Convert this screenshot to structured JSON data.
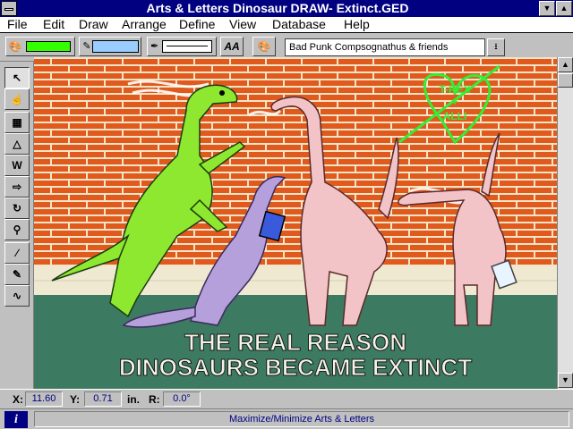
{
  "window": {
    "title": "Arts & Letters Dinosaur DRAW- Extinct.GED",
    "minimize_glyph": "▼",
    "maximize_glyph": "▲"
  },
  "menu": {
    "items": [
      "File",
      "Edit",
      "Draw",
      "Arrange",
      "Define",
      "View",
      "Database",
      "Help"
    ]
  },
  "toolbar": {
    "fill_color": "#33ff00",
    "line_color": "#99ccff",
    "font_button_label": "AA",
    "style_name": "Bad Punk Compsognathus & friends"
  },
  "palette": {
    "tools": [
      {
        "name": "select-tool",
        "glyph": "↖"
      },
      {
        "name": "hand-tool",
        "glyph": "☝"
      },
      {
        "name": "symbols-tool",
        "glyph": "▦"
      },
      {
        "name": "shapes-tool",
        "glyph": "△"
      },
      {
        "name": "text-tool",
        "glyph": "W"
      },
      {
        "name": "blend-tool",
        "glyph": "⇨"
      },
      {
        "name": "rotate-tool",
        "glyph": "↻"
      },
      {
        "name": "zoom-tool",
        "glyph": "⚲"
      },
      {
        "name": "line-tool",
        "glyph": "∕"
      },
      {
        "name": "freehand-tool",
        "glyph": "✎"
      },
      {
        "name": "curve-tool",
        "glyph": "∿"
      }
    ]
  },
  "artwork": {
    "graffiti_line1": "T-REX",
    "graffiti_line2": "+",
    "graffiti_line3": "ALLI",
    "headline_1": "THE REAL REASON",
    "headline_2": "DINOSAURS BECAME EXTINCT",
    "colors": {
      "brick": "#e05a1e",
      "mortar": "#f4e4c8",
      "sidewalk": "#efe9d2",
      "street": "#3d7a62",
      "green_dino": "#8ee830",
      "purple_dino": "#b6a0dc",
      "pink_dino": "#f2c4c8",
      "graffiti": "#33ee33"
    }
  },
  "coords": {
    "x_label": "X:",
    "x_value": "11.60",
    "y_label": "Y:",
    "y_value": "0.71",
    "unit": "in.",
    "r_label": "R:",
    "r_value": "0.0°"
  },
  "status": {
    "info_icon": "i",
    "message": "Maximize/Minimize Arts & Letters"
  }
}
